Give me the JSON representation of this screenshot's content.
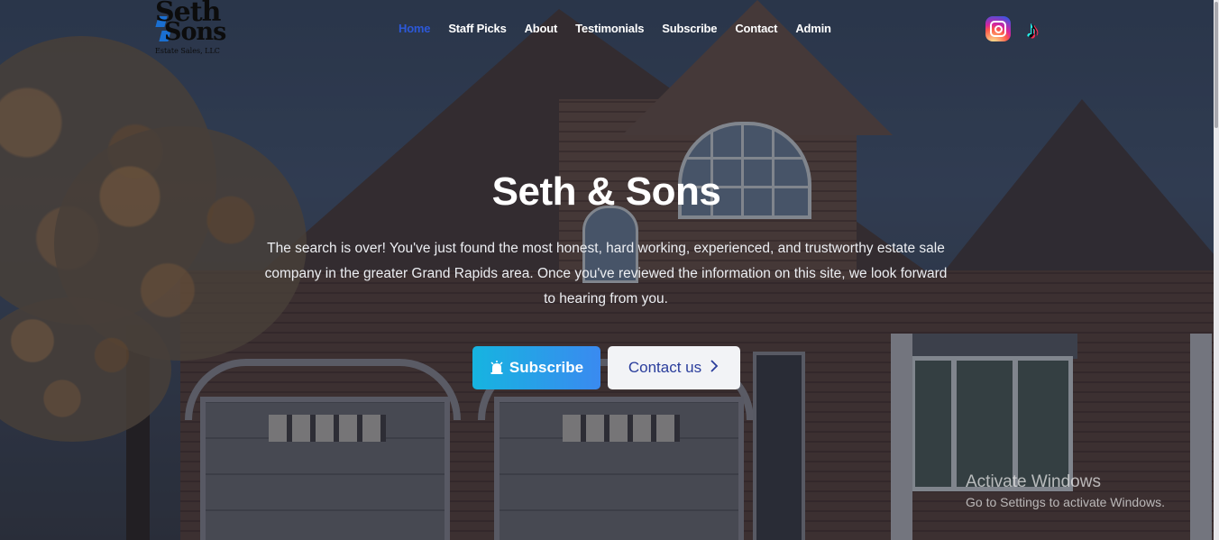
{
  "logo": {
    "line1": "Seth",
    "line2": "Sons",
    "line3": "Estate Sales, LLC"
  },
  "nav": {
    "items": [
      {
        "label": "Home",
        "active": true
      },
      {
        "label": "Staff Picks"
      },
      {
        "label": "About"
      },
      {
        "label": "Testimonials"
      },
      {
        "label": "Subscribe"
      },
      {
        "label": "Contact"
      },
      {
        "label": "Admin"
      }
    ]
  },
  "social": {
    "icons": [
      "instagram-icon",
      "tiktok-icon"
    ]
  },
  "hero": {
    "title": "Seth & Sons",
    "text": "The search is over!  You've just found the most honest, hard working, experienced, and trustworthy estate sale company in the greater Grand Rapids area.  Once you've reviewed the information on this site, we look forward to hearing from you.",
    "subscribe_label": "Subscribe",
    "contact_label": "Contact us"
  },
  "watermark": {
    "title": "Activate Windows",
    "subtitle": "Go to Settings to activate Windows."
  },
  "colors": {
    "nav_active": "#2c58d8",
    "subscribe_start": "#16b4e0",
    "subscribe_end": "#3a8af0",
    "contact_text": "#2a3d9c"
  }
}
